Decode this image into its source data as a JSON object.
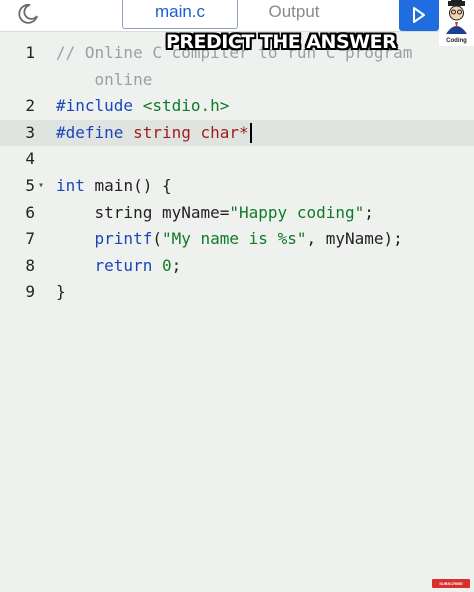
{
  "tabs": {
    "main": "main.c",
    "output": "Output"
  },
  "caption": "PREDICT THE ANSWER",
  "logo_text": "Coding",
  "badge": "SUBSCRIBE",
  "lines": [
    {
      "num": "1",
      "parts": [
        [
          "tk-comment",
          "// Online C compiler to run C program"
        ]
      ]
    },
    {
      "num": "",
      "parts": [
        [
          "tk-comment",
          "    online"
        ]
      ]
    },
    {
      "num": "2",
      "parts": [
        [
          "tk-kw",
          "#include"
        ],
        [
          "",
          " "
        ],
        [
          "tk-str",
          "<stdio.h>"
        ]
      ]
    },
    {
      "num": "3",
      "active": true,
      "cursor": true,
      "parts": [
        [
          "tk-kw",
          "#define"
        ],
        [
          "",
          " "
        ],
        [
          "tk-red",
          "string char*"
        ]
      ]
    },
    {
      "num": "4",
      "parts": []
    },
    {
      "num": "5",
      "fold": true,
      "parts": [
        [
          "tk-kw",
          "int"
        ],
        [
          "",
          " main() {"
        ]
      ]
    },
    {
      "num": "6",
      "parts": [
        [
          "",
          "    string myName="
        ],
        [
          "tk-str",
          "\"Happy coding\""
        ],
        [
          "",
          ";"
        ]
      ]
    },
    {
      "num": "7",
      "parts": [
        [
          "tk-kw",
          "    printf"
        ],
        [
          "",
          "("
        ],
        [
          "tk-str",
          "\"My name is %s\""
        ],
        [
          "",
          ", myName);"
        ]
      ]
    },
    {
      "num": "8",
      "parts": [
        [
          "tk-kw",
          "    return"
        ],
        [
          "",
          " "
        ],
        [
          "tk-num",
          "0"
        ],
        [
          "",
          ";"
        ]
      ]
    },
    {
      "num": "9",
      "parts": [
        [
          "",
          "}"
        ]
      ]
    }
  ]
}
